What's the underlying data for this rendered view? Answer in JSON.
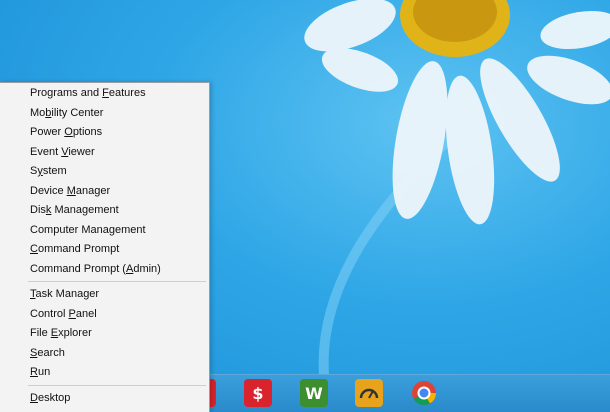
{
  "context_menu": {
    "groups": [
      [
        {
          "label": "Programs and Features",
          "access": "F"
        },
        {
          "label": "Mobility Center",
          "access": "b"
        },
        {
          "label": "Power Options",
          "access": "O"
        },
        {
          "label": "Event Viewer",
          "access": "V"
        },
        {
          "label": "System",
          "access": "y"
        },
        {
          "label": "Device Manager",
          "access": "M"
        },
        {
          "label": "Disk Management",
          "access": "k"
        },
        {
          "label": "Computer Management",
          "access": "G"
        },
        {
          "label": "Command Prompt",
          "access": "C"
        },
        {
          "label": "Command Prompt (Admin)",
          "access": "A"
        }
      ],
      [
        {
          "label": "Task Manager",
          "access": "T"
        },
        {
          "label": "Control Panel",
          "access": "P"
        },
        {
          "label": "File Explorer",
          "access": "E"
        },
        {
          "label": "Search",
          "access": "S"
        },
        {
          "label": "Run",
          "access": "R"
        }
      ],
      [
        {
          "label": "Desktop",
          "access": "D"
        }
      ]
    ]
  },
  "taskbar": {
    "icons": [
      {
        "name": "security-app-icon",
        "color": "#d9232d"
      },
      {
        "name": "money-app-icon",
        "color": "#d9232d",
        "glyph": "$"
      },
      {
        "name": "winamp-icon",
        "color": "#3c8e2e",
        "glyph": "W"
      },
      {
        "name": "speedometer-icon",
        "color": "#e8a31c"
      },
      {
        "name": "chrome-icon",
        "color": "#db4437"
      }
    ]
  },
  "colors": {
    "wallpaper": "#2ea6e6",
    "menu_background": "#f3f3f3"
  }
}
